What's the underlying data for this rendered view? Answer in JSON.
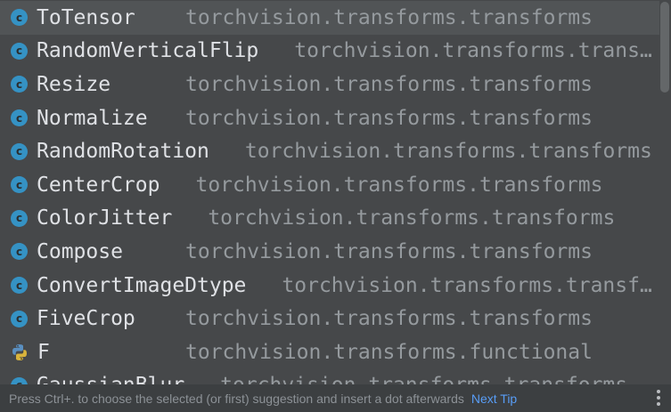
{
  "completion": {
    "items": [
      {
        "icon": "class-icon",
        "name": "ToTensor",
        "location": "torchvision.transforms.transforms",
        "selected": true
      },
      {
        "icon": "class-icon",
        "name": "RandomVerticalFlip",
        "location": "torchvision.transforms.transforms",
        "selected": false
      },
      {
        "icon": "class-icon",
        "name": "Resize",
        "location": "torchvision.transforms.transforms",
        "selected": false
      },
      {
        "icon": "class-icon",
        "name": "Normalize",
        "location": "torchvision.transforms.transforms",
        "selected": false
      },
      {
        "icon": "class-icon",
        "name": "RandomRotation",
        "location": "torchvision.transforms.transforms",
        "selected": false
      },
      {
        "icon": "class-icon",
        "name": "CenterCrop",
        "location": "torchvision.transforms.transforms",
        "selected": false
      },
      {
        "icon": "class-icon",
        "name": "ColorJitter",
        "location": "torchvision.transforms.transforms",
        "selected": false
      },
      {
        "icon": "class-icon",
        "name": "Compose",
        "location": "torchvision.transforms.transforms",
        "selected": false
      },
      {
        "icon": "class-icon",
        "name": "ConvertImageDtype",
        "location": "torchvision.transforms.transforms",
        "selected": false
      },
      {
        "icon": "class-icon",
        "name": "FiveCrop",
        "location": "torchvision.transforms.transforms",
        "selected": false
      },
      {
        "icon": "python-module-icon",
        "name": "F",
        "location": "torchvision.transforms.functional",
        "selected": false
      },
      {
        "icon": "class-icon",
        "name": "GaussianBlur",
        "location": "torchvision.transforms.transforms",
        "selected": false
      }
    ],
    "class_icon_glyph": "c"
  },
  "footer": {
    "hint": "Press Ctrl+. to choose the selected (or first) suggestion and insert a dot afterwards",
    "next_tip": "Next Tip",
    "more_icon": "vertical-ellipsis-icon"
  },
  "colors": {
    "background": "#46484a",
    "selected_row": "#515456",
    "class_icon": "#3592c4",
    "name_text": "#dfe1e5",
    "location_text": "#959a9e",
    "link": "#589df6"
  }
}
